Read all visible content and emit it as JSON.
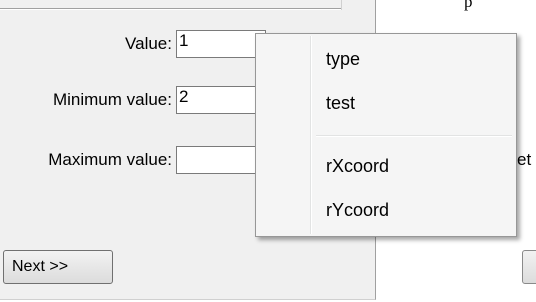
{
  "form": {
    "value_label": "Value:",
    "value_field": "1",
    "min_label": "Minimum value:",
    "min_field": "2",
    "max_label": "Maximum value:",
    "max_field": ""
  },
  "buttons": {
    "next_label": "Next >>"
  },
  "clipped": {
    "right_text": "et",
    "top_text": "p"
  },
  "context_menu": {
    "items": [
      "type",
      "test",
      "rXcoord",
      "rYcoord"
    ]
  }
}
